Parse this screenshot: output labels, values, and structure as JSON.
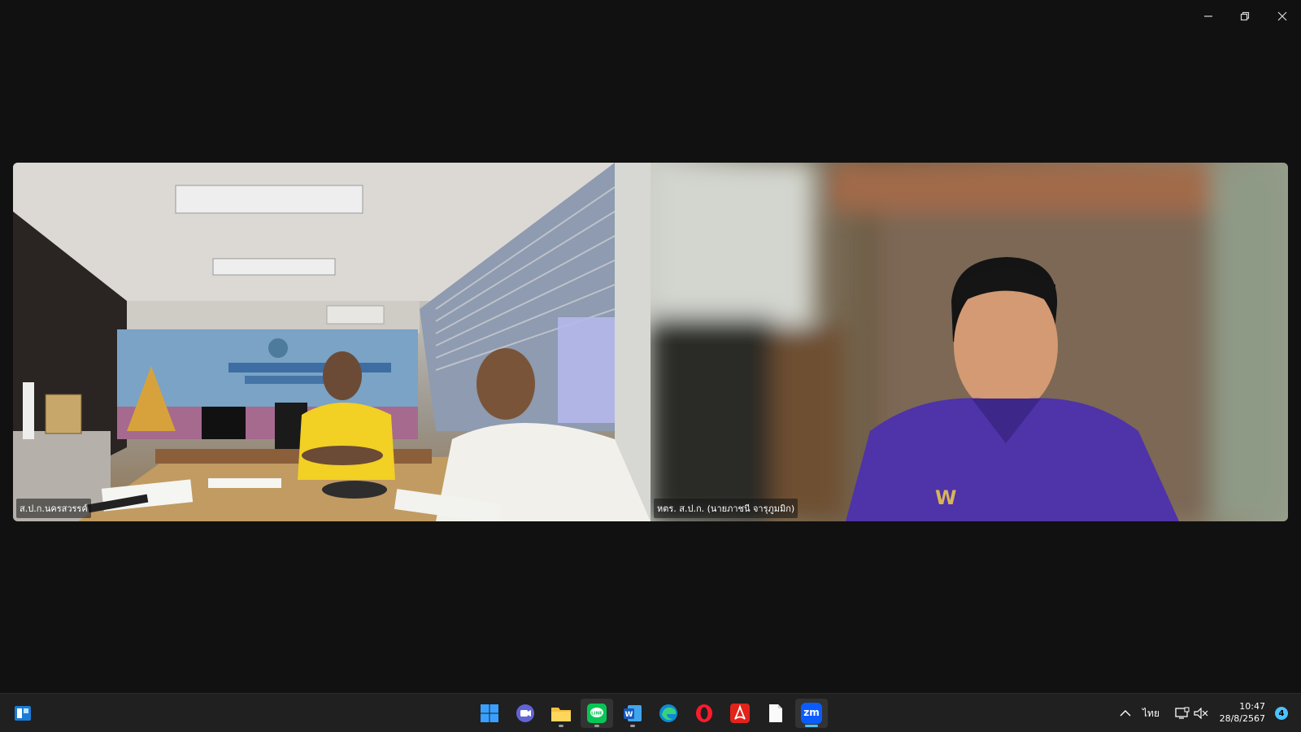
{
  "window": {
    "controls": [
      "minimize",
      "restore",
      "close"
    ]
  },
  "participants": [
    {
      "name": "ส.ป.ก.นครสวรรค์"
    },
    {
      "name": "หตร. ส.ป.ก. (นายภาชนี  จารุภูมมิก)"
    }
  ],
  "taskbar": {
    "apps": [
      {
        "icon": "widgets-icon"
      },
      {
        "icon": "windows-start-icon"
      },
      {
        "icon": "teams-chat-icon"
      },
      {
        "icon": "file-explorer-icon"
      },
      {
        "icon": "line-icon"
      },
      {
        "icon": "word-icon"
      },
      {
        "icon": "edge-icon"
      },
      {
        "icon": "opera-icon"
      },
      {
        "icon": "acrobat-icon"
      },
      {
        "icon": "notepad-icon"
      },
      {
        "icon": "zoom-icon",
        "label": "zm"
      }
    ],
    "tray": {
      "language": "ไทย",
      "time": "10:47",
      "date": "28/8/2567",
      "notification_count": "4"
    }
  },
  "colors": {
    "accent": "#4cc2ff",
    "background": "#111111",
    "taskbar": "#202020"
  }
}
